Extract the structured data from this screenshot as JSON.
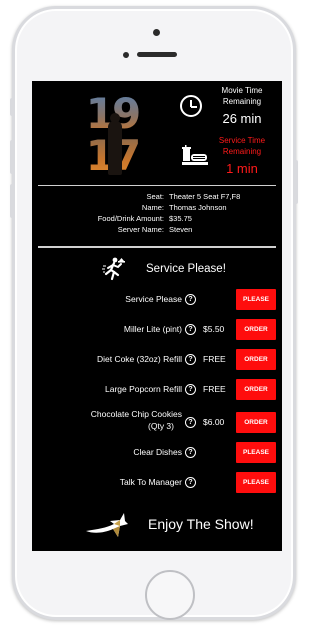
{
  "movie": {
    "poster_text_top": "19",
    "poster_text_bottom": "17",
    "time_label": "Movie Time Remaining",
    "time_value": "26 min",
    "service_label": "Service Time Remaining",
    "service_value": "1 min"
  },
  "info": [
    {
      "key": "Seat:",
      "value": "Theater 5 Seat F7,F8"
    },
    {
      "key": "Name:",
      "value": "Thomas Johnson"
    },
    {
      "key": "Food/Drink Amount:",
      "value": "$35.75"
    },
    {
      "key": "Server Name:",
      "value": "Steven"
    }
  ],
  "service_header": "Service Please!",
  "help_glyph": "?",
  "rows": [
    {
      "label": "Service Please",
      "price": "",
      "button": "PLEASE"
    },
    {
      "label": "Miller Lite (pint)",
      "price": "$5.50",
      "button": "ORDER"
    },
    {
      "label": "Diet Coke (32oz) Refill",
      "price": "FREE",
      "button": "ORDER"
    },
    {
      "label": "Large Popcorn Refill",
      "price": "FREE",
      "button": "ORDER"
    },
    {
      "label_line1": "Chocolate Chip Cookies",
      "label_line2": "(Qty 3)",
      "price": "$6.00",
      "button": "ORDER"
    },
    {
      "label": "Clear Dishes",
      "price": "",
      "button": "PLEASE"
    },
    {
      "label": "Talk To Manager",
      "price": "",
      "button": "PLEASE"
    }
  ],
  "footer_text": "Enjoy The Show!",
  "colors": {
    "screen_bg": "#000000",
    "accent_red": "#ff0d0d",
    "alert_red": "#ff1a1a",
    "text": "#ffffff"
  },
  "icons": {
    "clock": "clock-icon",
    "food": "food-tray-icon",
    "runner": "waiter-running-icon",
    "help": "question-circle-icon",
    "logo": "star-logo-icon"
  }
}
